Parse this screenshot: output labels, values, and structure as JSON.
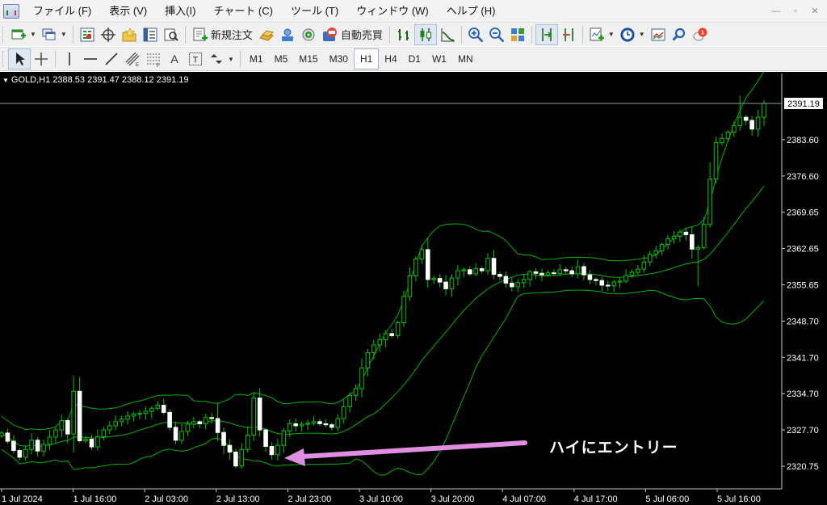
{
  "menu": {
    "items": [
      "ファイル (F)",
      "表示 (V)",
      "挿入(I)",
      "チャート (C)",
      "ツール (T)",
      "ウィンドウ (W)",
      "ヘルプ (H)"
    ]
  },
  "toolbar": {
    "new_order_label": "新規注文",
    "auto_trade_label": "自動売買",
    "alert_count": "1"
  },
  "timeframes": [
    "M1",
    "M5",
    "M15",
    "M30",
    "H1",
    "H4",
    "D1",
    "W1",
    "MN"
  ],
  "active_timeframe": "H1",
  "chart": {
    "symbol_header": "GOLD,H1  2388.53 2391.47 2388.12 2391.19",
    "current_price_label": "2391.19",
    "annotation_text": "ハイにエントリー"
  },
  "colors": {
    "background": "#000000",
    "grid_frame": "#c8c8c8",
    "candle_up_outline": "#00c800",
    "candle_down_fill": "#ffffff",
    "wick": "#00c800",
    "bands": "#00b400",
    "arrow": "#e08fe0"
  },
  "chart_data": {
    "type": "candlestick",
    "price_axis_labels": [
      "2391.19",
      "2383.60",
      "2376.60",
      "2369.65",
      "2362.65",
      "2355.65",
      "2348.70",
      "2341.70",
      "2334.70",
      "2327.70",
      "2320.75"
    ],
    "time_axis_labels": [
      "1 Jul 2024",
      "1 Jul 16:00",
      "2 Jul 03:00",
      "2 Jul 13:00",
      "2 Jul 23:00",
      "3 Jul 10:00",
      "3 Jul 20:00",
      "4 Jul 07:00",
      "4 Jul 17:00",
      "5 Jul 06:00",
      "5 Jul 16:00"
    ],
    "close_series": [
      2327.2,
      2325.6,
      2323.8,
      2322.5,
      2324.0,
      2325.8,
      2323.7,
      2325.0,
      2326.4,
      2327.8,
      2329.6,
      2327.0,
      2335.3,
      2325.7,
      2326.0,
      2324.5,
      2326.5,
      2327.8,
      2328.6,
      2329.4,
      2329.9,
      2330.5,
      2330.9,
      2331.0,
      2331.4,
      2332.0,
      2332.6,
      2331.2,
      2328.3,
      2325.8,
      2327.5,
      2328.9,
      2329.4,
      2329.0,
      2330.2,
      2330.0,
      2327.3,
      2324.8,
      2323.5,
      2320.8,
      2324.0,
      2326.8,
      2334.0,
      2327.8,
      2324.6,
      2323.0,
      2324.8,
      2327.6,
      2329.0,
      2328.6,
      2328.9,
      2329.1,
      2329.4,
      2329.0,
      2328.8,
      2328.3,
      2330.0,
      2332.3,
      2334.5,
      2335.8,
      2339.8,
      2342.8,
      2344.3,
      2345.3,
      2346.5,
      2346.1,
      2348.6,
      2353.7,
      2357.7,
      2361.0,
      2362.8,
      2357.0,
      2357.2,
      2356.5,
      2355.2,
      2357.3,
      2358.7,
      2358.9,
      2358.1,
      2359.1,
      2358.7,
      2361.1,
      2358.0,
      2357.6,
      2356.3,
      2355.6,
      2356.4,
      2357.0,
      2358.5,
      2358.2,
      2357.9,
      2358.3,
      2358.2,
      2358.9,
      2358.7,
      2358.1,
      2359.5,
      2357.9,
      2357.0,
      2356.8,
      2355.9,
      2355.8,
      2356.5,
      2356.7,
      2357.8,
      2358.4,
      2359.0,
      2360.4,
      2361.9,
      2362.6,
      2363.8,
      2364.9,
      2365.4,
      2366.2,
      2365.7,
      2362.9,
      2363.2,
      2367.7,
      2376.5,
      2383.6,
      2384.4,
      2385.6,
      2386.9,
      2388.5,
      2387.9,
      2386.2,
      2388.5,
      2391.2
    ]
  }
}
